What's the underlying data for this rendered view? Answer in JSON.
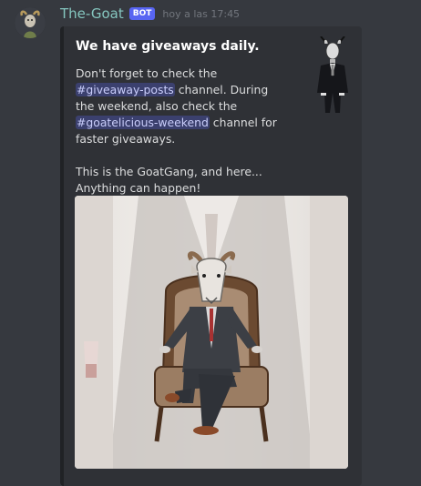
{
  "message": {
    "username": "The-Goat",
    "bot_badge": "BOT",
    "timestamp": "hoy a las 17:45"
  },
  "embed": {
    "title": "We have giveaways daily.",
    "desc_part1": "Don't forget to check the ",
    "mention_giveaway": "#giveaway-posts",
    "desc_part2": " channel. During the weekend, also check the ",
    "mention_goatelicious": "#goatelicious-weekend",
    "desc_part3": " channel for faster giveaways.",
    "desc_line_a": "This is the GoatGang, and here...",
    "desc_line_b": "Anything can happen!"
  },
  "colors": {
    "username": "#85c6bf",
    "bot_badge": "#5865f2",
    "mention_bg": "#3e4374"
  }
}
